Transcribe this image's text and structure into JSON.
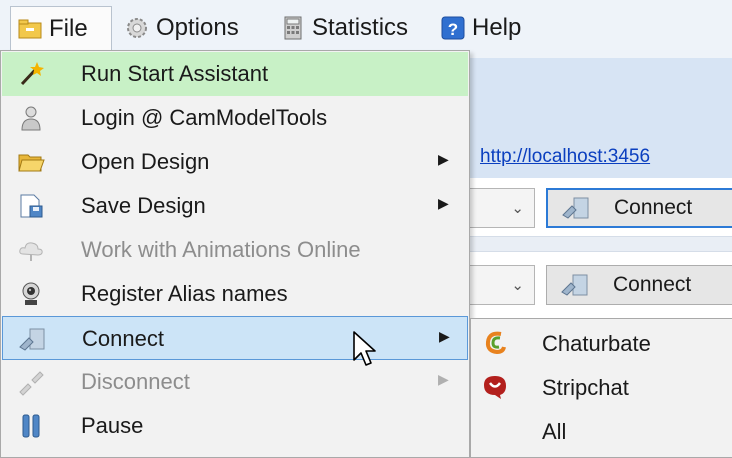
{
  "menubar": {
    "items": [
      {
        "label": "File",
        "icon": "folder-icon"
      },
      {
        "label": "Options",
        "icon": "gears-icon"
      },
      {
        "label": "Statistics",
        "icon": "calculator-icon"
      },
      {
        "label": "Help",
        "icon": "help-icon"
      }
    ]
  },
  "background": {
    "url_link": "http://localhost:3456",
    "connect_button_1": "Connect",
    "connect_button_2": "Connect"
  },
  "file_menu": {
    "items": [
      {
        "label": "Run Start Assistant",
        "icon": "magic-wand-icon",
        "state": "highlighted"
      },
      {
        "label": "Login @ CamModelTools",
        "icon": "user-icon"
      },
      {
        "label": "Open Design",
        "icon": "open-folder-icon",
        "submenu": true
      },
      {
        "label": "Save Design",
        "icon": "save-document-icon",
        "submenu": true
      },
      {
        "label": "Work with Animations Online",
        "icon": "cloud-icon",
        "disabled": true
      },
      {
        "label": "Register Alias names",
        "icon": "webcam-icon"
      },
      {
        "label": "Connect",
        "icon": "plug-icon",
        "submenu": true,
        "state": "selected"
      },
      {
        "label": "Disconnect",
        "icon": "unplug-icon",
        "submenu": true,
        "disabled": true
      },
      {
        "label": "Pause",
        "icon": "pause-icon"
      }
    ]
  },
  "connect_submenu": {
    "items": [
      {
        "label": "Chaturbate",
        "icon": "chaturbate-icon"
      },
      {
        "label": "Stripchat",
        "icon": "stripchat-icon"
      },
      {
        "label": "All",
        "icon": ""
      }
    ]
  },
  "colors": {
    "highlight_green": "#c8f1c6",
    "highlight_blue": "#cce4f7",
    "selection_border": "#5a98d8",
    "link": "#0b3fbf"
  }
}
